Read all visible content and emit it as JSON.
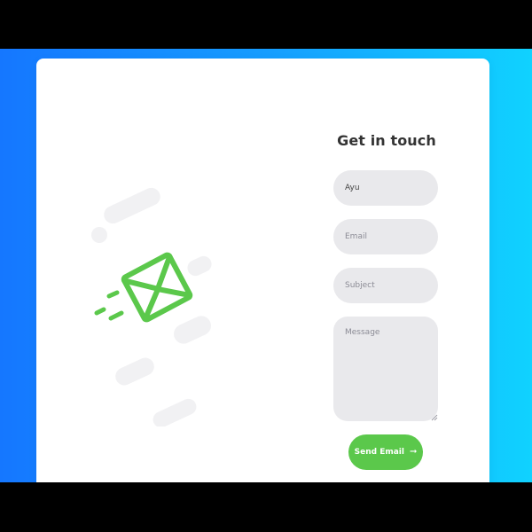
{
  "contact": {
    "title": "Get in touch",
    "name_value": "Ayu",
    "email_placeholder": "Email",
    "subject_placeholder": "Subject",
    "message_placeholder": "Message",
    "send_label": "Send Email",
    "send_icon": "arrow-right-icon"
  },
  "colors": {
    "background_start": "#1577ff",
    "background_end": "#10d2ff",
    "envelope": "#5bc84b",
    "button": "#5bc84b",
    "field_background": "#e9e9ec"
  }
}
